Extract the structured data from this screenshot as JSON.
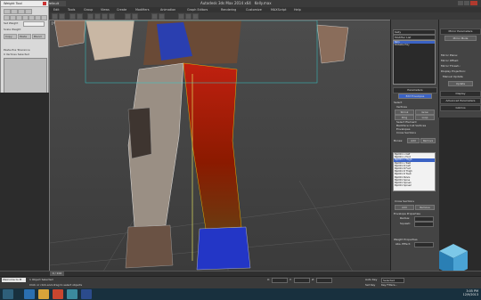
{
  "titlebar": {
    "app_title": "Autodesk 3ds Max 2014 x64",
    "file": "Kelly.max",
    "workspace": "Workspace: Default"
  },
  "menu": [
    "Edit",
    "Tools",
    "Group",
    "Views",
    "Create",
    "Modifiers",
    "Animation",
    "Graph Editors",
    "Rendering",
    "Customize",
    "MAXScript",
    "Help"
  ],
  "viewport": {
    "label": "[+] [Front] [Realistic]"
  },
  "weight_tool": {
    "title": "Weight Tool",
    "copy": "Copy",
    "paste": "Paste",
    "set_weight": "Set Weight",
    "scale_weight": "Scale Weight",
    "blend": "Blend",
    "normalize": "Normalize",
    "label_a": "Paste-Pos Tolerance",
    "label_b": "0 Vertices Selected"
  },
  "cmd_panel": {
    "name": "Kelly",
    "modifier_list": "Modifier List",
    "stack": [
      "Skin",
      "Editable Poly"
    ],
    "parameters": "Parameters",
    "edit_envelopes": "Edit Envelopes",
    "select_label": "Select",
    "vertices": "Vertices",
    "shrink": "Shrink",
    "grow": "Grow",
    "ring": "Ring",
    "loop": "Loop",
    "select_element": "Select Element",
    "backface": "Backface Cull Vertices",
    "envelopes": "Envelopes",
    "cross_sections": "Cross Sections",
    "bones_label": "Bones:",
    "add": "Add",
    "remove": "Remove",
    "bones": [
      "Bip001 L Calf",
      "Bip001 L Foot",
      "Bip001 L Thigh",
      "Bip001 L Toe0",
      "Bip001 R Calf",
      "Bip001 R Foot",
      "Bip001 R Thigh",
      "Bip001 R Toe0",
      "Bip001 Pelvis",
      "Bip001 Spine",
      "Bip001 Spine1",
      "Bip001 Spine2"
    ],
    "selected_bone": 2,
    "cross_section_label": "Cross Sections",
    "envelope_properties": "Envelope Properties",
    "radius": "Radius:",
    "squash": "Squash:",
    "weight_properties": "Weight Properties",
    "abs_effect": "Abs. Effect:"
  },
  "mod_panel": {
    "mirror_params": "Mirror Parameters",
    "mirror_mode": "Mirror Mode",
    "mirror_plane": "Mirror Plane:",
    "mirror_offset": "Mirror Offset:",
    "mirror_thresh": "Mirror Thresh.:",
    "display_projection": "Display Projection:",
    "manual_update": "Manual Update",
    "update": "Update",
    "display": "Display",
    "advanced": "Advanced Parameters",
    "gizmos": "Gizmos"
  },
  "timeline": {
    "frame": "0 / 100"
  },
  "status": {
    "selected": "1 Object Selected",
    "prompt": "Welcome to M",
    "hint": "Click or click-and-drag to select objects",
    "x": "X:",
    "y": "Y:",
    "z": "Z:",
    "auto_key": "Auto Key",
    "selected_dropdown": "Selected",
    "set_key": "Set Key",
    "key_filters": "Key Filters..."
  },
  "clock": {
    "time": "3:05 PM",
    "date": "12/9/2013"
  },
  "colors": {
    "accent": "#3a62c4",
    "taskbar": "#18303e"
  }
}
